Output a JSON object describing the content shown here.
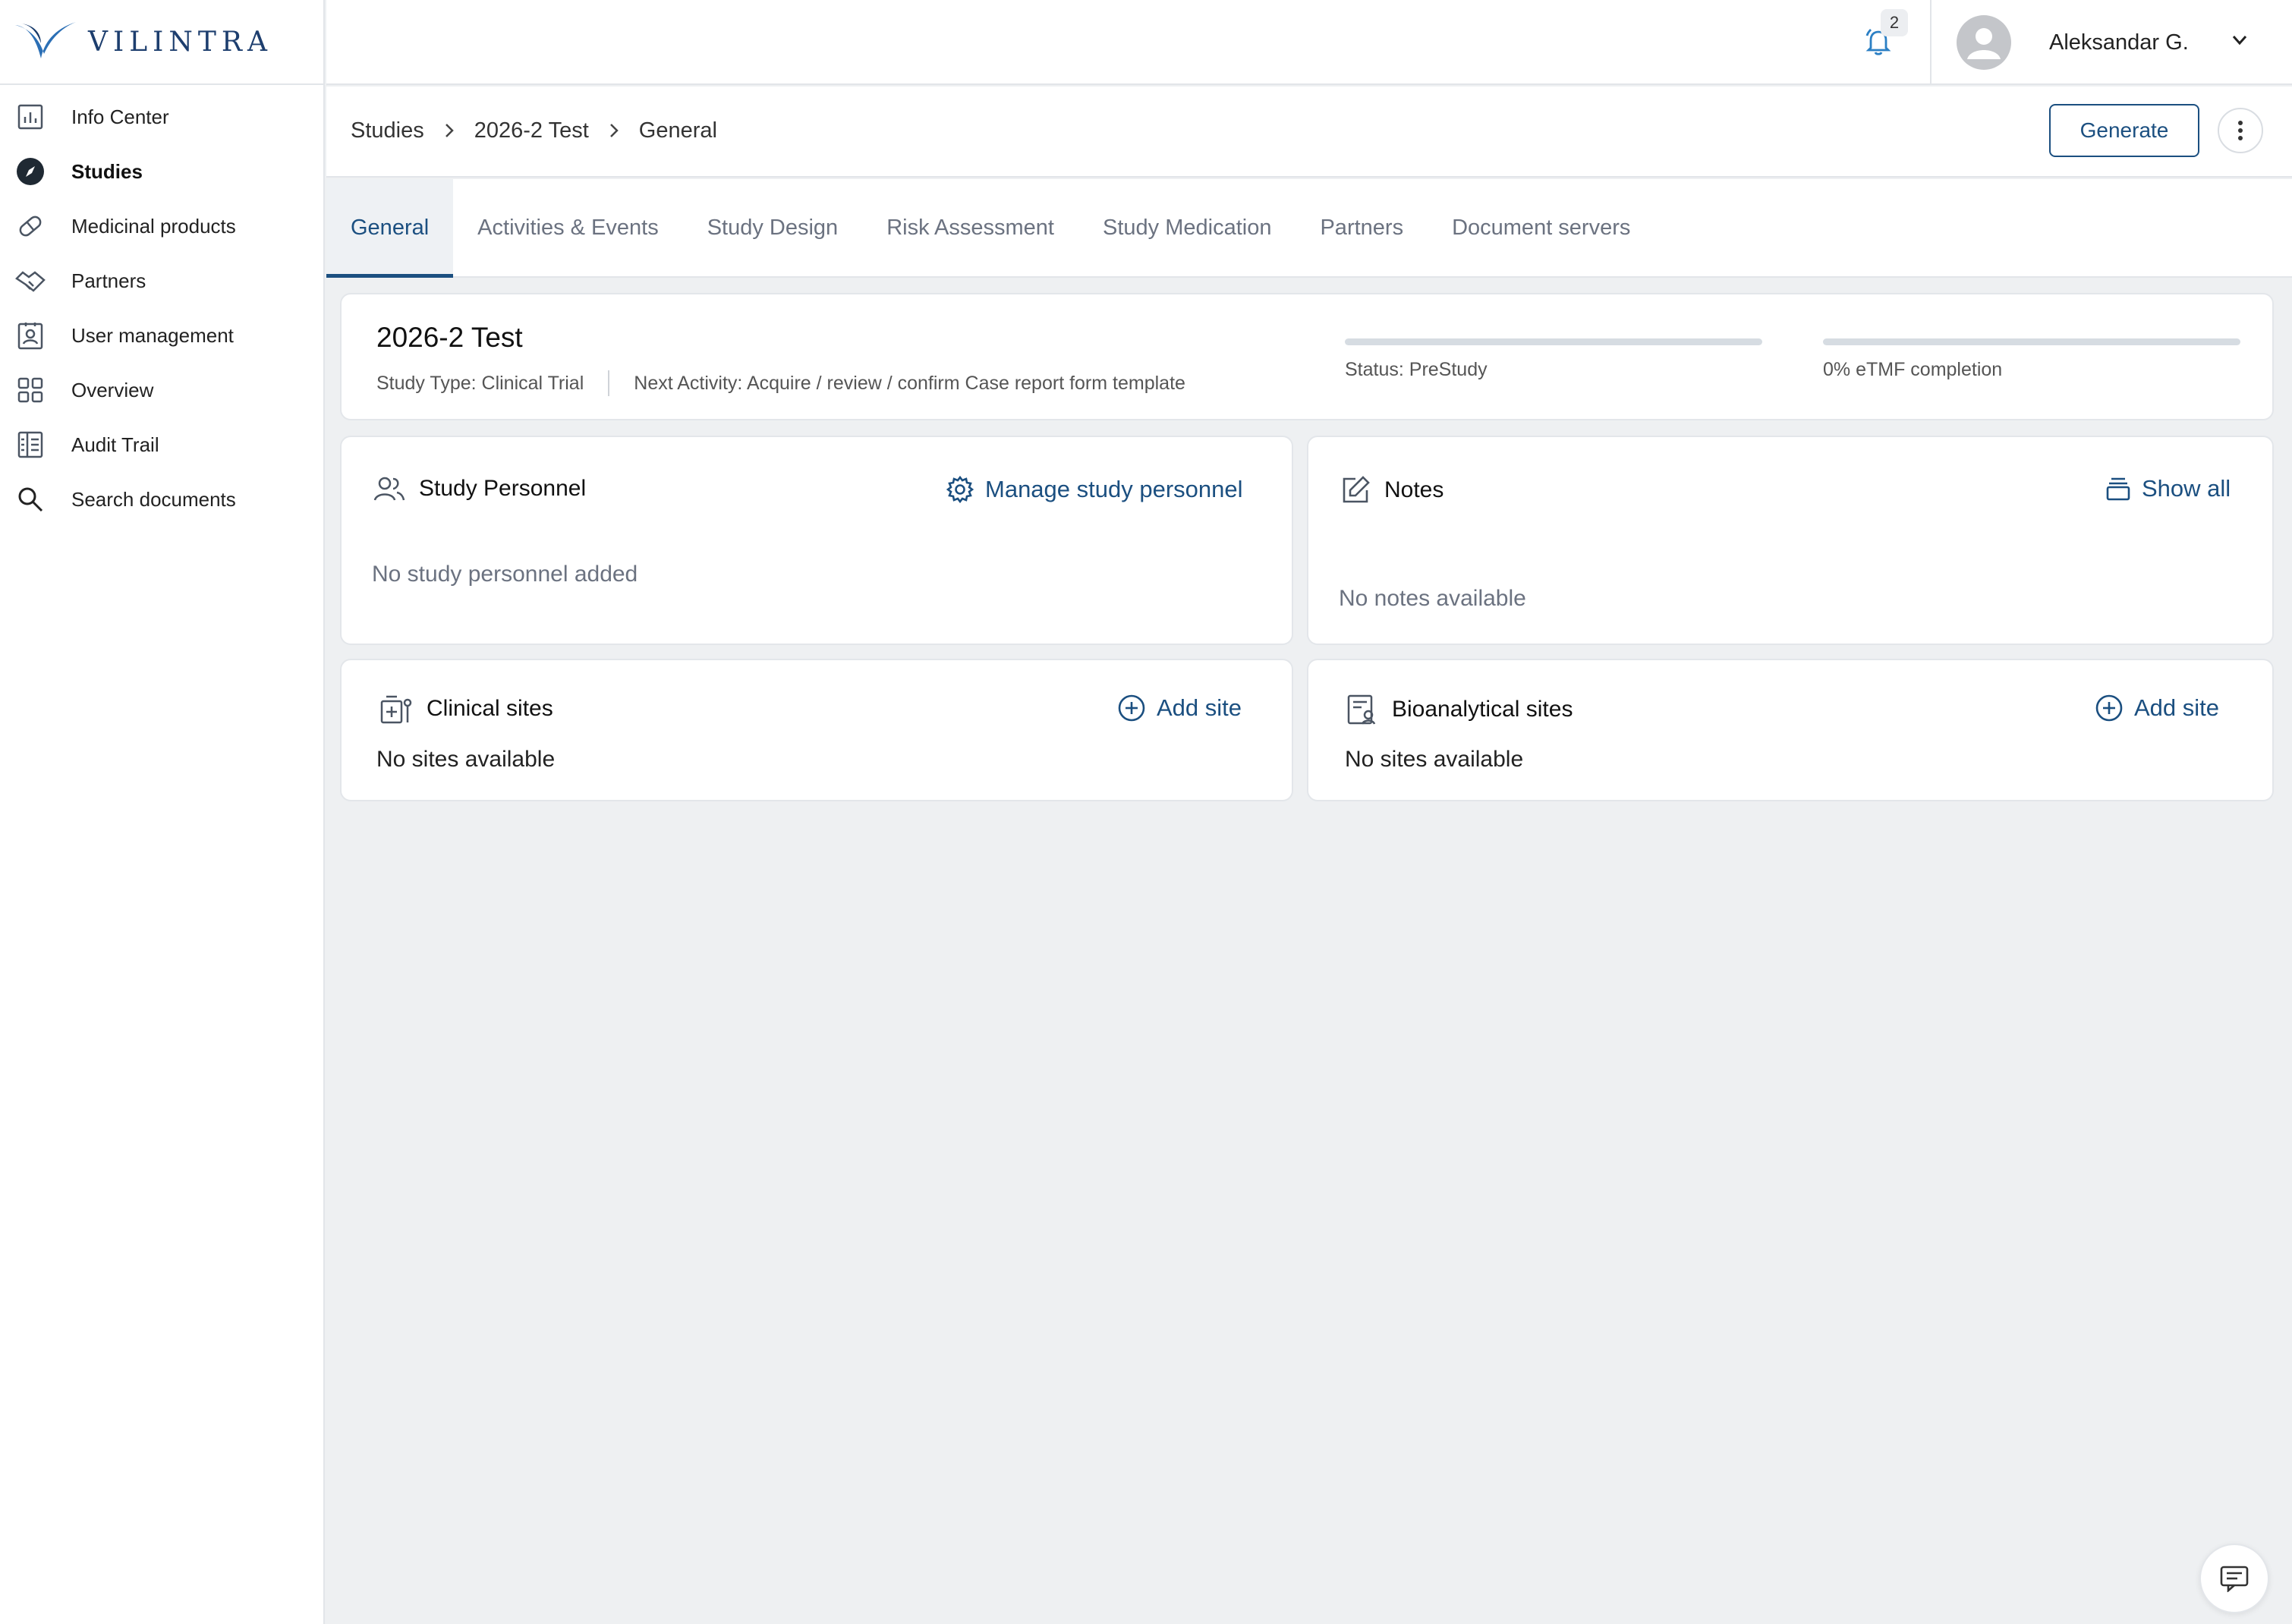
{
  "app": {
    "brand": "VILINTRA"
  },
  "sidebar": {
    "items": [
      {
        "label": "Info Center",
        "icon": "chart-icon",
        "active": false
      },
      {
        "label": "Studies",
        "icon": "compass-icon",
        "active": true
      },
      {
        "label": "Medicinal products",
        "icon": "pill-icon",
        "active": false
      },
      {
        "label": "Partners",
        "icon": "handshake-icon",
        "active": false
      },
      {
        "label": "User management",
        "icon": "user-badge-icon",
        "active": false
      },
      {
        "label": "Overview",
        "icon": "grid-icon",
        "active": false
      },
      {
        "label": "Audit Trail",
        "icon": "ledger-icon",
        "active": false
      },
      {
        "label": "Search documents",
        "icon": "search-icon",
        "active": false
      }
    ]
  },
  "header": {
    "notifications_count": "2",
    "user_name": "Aleksandar G."
  },
  "breadcrumb": [
    "Studies",
    "2026-2 Test",
    "General"
  ],
  "toolbar": {
    "generate_label": "Generate"
  },
  "tabs": [
    {
      "label": "General",
      "active": true
    },
    {
      "label": "Activities & Events",
      "active": false
    },
    {
      "label": "Study Design",
      "active": false
    },
    {
      "label": "Risk Assessment",
      "active": false
    },
    {
      "label": "Study Medication",
      "active": false
    },
    {
      "label": "Partners",
      "active": false
    },
    {
      "label": "Document servers",
      "active": false
    }
  ],
  "study": {
    "title": "2026-2 Test",
    "type": "Study Type: Clinical Trial",
    "next_activity": "Next Activity: Acquire / review / confirm Case report form template",
    "status_label": "Status: PreStudy",
    "status_progress": 0,
    "etmf_label": "0% eTMF completion",
    "etmf_progress": 0
  },
  "personnel": {
    "title": "Study Personnel",
    "action": "Manage study personnel",
    "empty": "No study personnel added"
  },
  "notes": {
    "title": "Notes",
    "action": "Show all",
    "empty": "No notes available"
  },
  "clinical_sites": {
    "title": "Clinical sites",
    "action": "Add site",
    "empty": "No sites available"
  },
  "bioanalytical_sites": {
    "title": "Bioanalytical sites",
    "action": "Add site",
    "empty": "No sites available"
  },
  "colors": {
    "accent": "#1b4f80",
    "background": "#eef0f2",
    "progress_track": "#d6dce2"
  }
}
